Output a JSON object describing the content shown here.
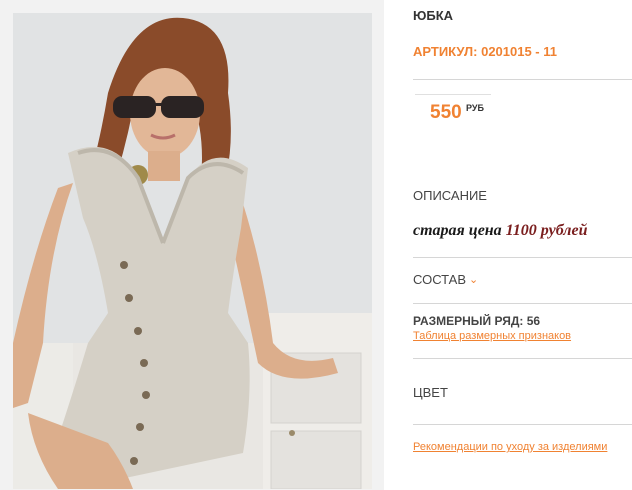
{
  "product": {
    "title": "ЮБКА",
    "sku": "АРТИКУЛ: 0201015 - 11",
    "price": "550",
    "currency": "РУБ"
  },
  "description": {
    "label": "ОПИСАНИЕ",
    "old_price_prefix": "старая цена",
    "old_price_value": "1100",
    "old_price_suffix": "рублей"
  },
  "composition": {
    "label": "СОСТАВ"
  },
  "sizes": {
    "label": "РАЗМЕРНЫЙ РЯД: 56",
    "table_link": "Таблица размерных признаков"
  },
  "color": {
    "label": "ЦВЕТ"
  },
  "care": {
    "link": "Рекомендации по уходу за изделиями"
  },
  "icons": {
    "composition_toggle": "chevron-down-icon"
  },
  "colors": {
    "accent": "#f08232",
    "text": "#333333",
    "divider": "#d6d6d6"
  }
}
